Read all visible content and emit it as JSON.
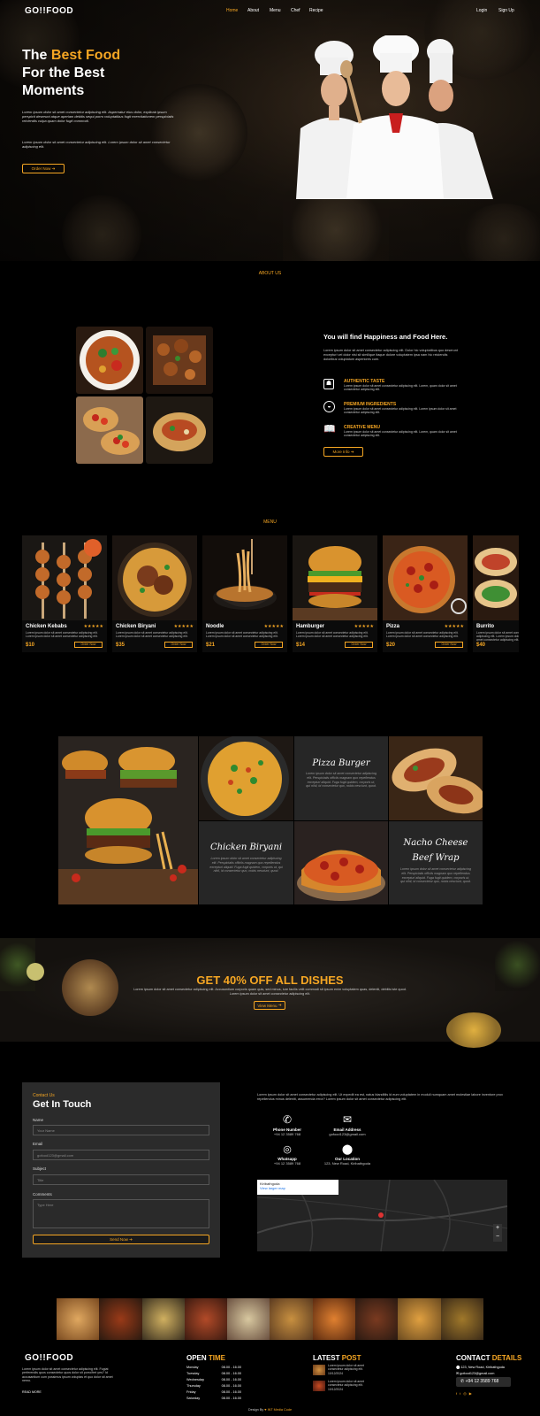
{
  "brand": {
    "logo": "GO!!FOOD"
  },
  "nav": {
    "items": [
      "Home",
      "About",
      "Menu",
      "Chef",
      "Recipe"
    ],
    "login": "Login",
    "signup": "Sign Up"
  },
  "hero": {
    "line1_a": "The ",
    "line1_b": "Best Food",
    "line2": "For the Best",
    "line3": "Moments",
    "text": "Lorem ipsum dolor sit amet consectetur adipiscing elit. Aspernatur eius dolor, explicab ipsum perspicit deserunt atque aperiam debitis sequi porro voluptatibus fugit exercitationem perspiciatis reiciendis culpa quam dolor fugit commodi.",
    "text2": "Lorem ipsum dolor sit amet consectetur adipiscing elit. Lorem ipsum dolor sit amet consectetur adipiscing elit.",
    "order": "Order Now"
  },
  "about": {
    "label": "ABOUT US",
    "title": "You will find Happiness and Food Here.",
    "text": "Lorem ipsum dolor sit amet consectetur adipiscing elit. Dolor hic voluptatibus quo deserunt excepturi vel dolor nisi sit similique itaque dolore voluptatem ipsa nam hic reiciendis doloribus voluptatum asperiores cum.",
    "features": [
      {
        "title": "AUTHENTIC TASTE",
        "text": "Lorem ipsum dolor sit amet consectetur adipiscing elit. Lorem, quam dolor sit amet consectetur adipiscing elit."
      },
      {
        "title": "PREMIUM INGREDIENTS",
        "text": "Lorem ipsum dolor sit amet consectetur adipiscing elit. Lorem ipsum dolor sit amet consectetur adipiscing elit."
      },
      {
        "title": "CREATIVE MENU",
        "text": "Lorem ipsum dolor sit amet consectetur adipiscing elit. Lorem, quam dolor sit amet consectetur adipiscing elit."
      }
    ],
    "more": "More Info"
  },
  "menu": {
    "label": "MENU",
    "desc": "Lorem ipsum dolor sit amet consectetur adipiscing elit. Lorem ipsum dolor sit amet consectetur adipiscing elit.",
    "order": "Order Now",
    "stars": "★★★★★",
    "items": [
      {
        "name": "Chicken Kebabs",
        "price": "$10"
      },
      {
        "name": "Chicken Biryani",
        "price": "$35"
      },
      {
        "name": "Noodle",
        "price": "$21"
      },
      {
        "name": "Hamburger",
        "price": "$14"
      },
      {
        "name": "Pizza",
        "price": "$20"
      },
      {
        "name": "Burrito",
        "price": "$40"
      }
    ]
  },
  "gallery": {
    "pizza_burger": "Pizza Burger",
    "chicken_biryani": "Chicken Biryani",
    "nacho1": "Nacho Cheese",
    "nacho2": "Beef Wrap",
    "desc": "Lorem ipsum dolor sit amet consectetur adipiscing elit. Perspiciatis officiis magnam quo repellendus excepturi aliquid. Fuga fugit quidem, corporis ut, qui nihil, id consectetur quo, nobis nesciunt, quod."
  },
  "promo": {
    "title": "GET 40% OFF ALL DISHES",
    "text": "Lorem ipsum dolor sit amet consectetur adipiscing elit. Accusantium corporis quam quis, sed minus, iure facilis velit commodi sit ipsum enim voluptatem quas, deleniti, debitis iste quod. Lorem ipsum dolor sit amet consectetur adipiscing elit.",
    "btn": "View Menu"
  },
  "contact": {
    "label": "Contact Us",
    "title": "Get In Touch",
    "fields": {
      "name": "Name",
      "name_ph": "Your Name",
      "email": "Email",
      "email_ph": "gofood123@gmail.com",
      "subject": "Subject",
      "subject_ph": "Title",
      "comments": "Comments",
      "comments_ph": "Type Here"
    },
    "send": "Send Now",
    "text": "Lorem ipsum dolor sit amet consectetur adipiscing elit. Ut expedit ea est, natus blanditiis id eum voluptatem in moduli numquam amet molestiae labore inventore prox repellendus minus deleniti, assumenda error? Lorem ipsum dolor sit amet consectetur adipiscing elit.",
    "phone_label": "Phone Number",
    "phone": "+94 12 3589 768",
    "email_label": "Email Address",
    "email": "gofood123@gmail.com",
    "wa_label": "Whatsapp",
    "wa": "+94 12 3589 768",
    "loc_label": "Our Location",
    "loc": "123, New Road, Kiribathgoda",
    "map_place": "Kiribathgoda",
    "map_link": "View larger map"
  },
  "footer": {
    "about": "Lorem ipsum dolor sit amet consectetur adipiscing elit. Fugiat perferendis quos consectetur quos dolor sit porro/fert yes? Id accusantium cum possimus ipsum voluptas et quo dolor sit amet nemo.",
    "more": "READ MORE",
    "open_a": "OPEN ",
    "open_b": "TIME",
    "hours": [
      {
        "d": "Monday",
        "t": "08.00 - 16.00"
      },
      {
        "d": "Tuesday",
        "t": "08.00 - 16.00"
      },
      {
        "d": "Wednesday",
        "t": "08.00 - 16.00"
      },
      {
        "d": "Thursday",
        "t": "08.00 - 16.00"
      },
      {
        "d": "Friday",
        "t": "08.00 - 16.00"
      },
      {
        "d": "Saturday",
        "t": "08.00 - 16.00"
      }
    ],
    "latest_a": "LATEST ",
    "latest_b": "POST",
    "post_text": "Lorem ipsum dolor sit amet consectetur adipiscing elit.",
    "post_date": "10/12/2024",
    "contact_a": "CONTACT ",
    "contact_b": "DETAILS",
    "addr": "123, New Road, Kiribathgoda",
    "mail": "gofood123@gmail.com",
    "phone": "+94 12 3589 768",
    "credit_a": "Design By ",
    "credit_b": "INT Media Code"
  }
}
